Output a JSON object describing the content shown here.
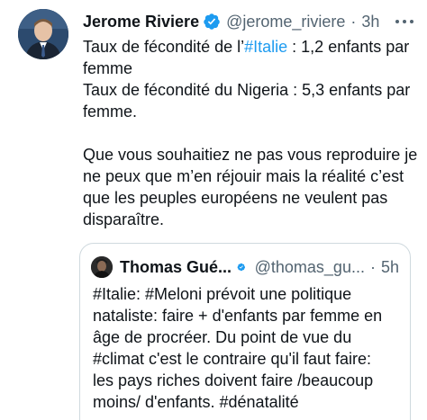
{
  "tweet": {
    "author": {
      "name": "Jerome Riviere",
      "handle": "@jerome_riviere",
      "separator": "·",
      "time": "3h"
    },
    "lines": [
      {
        "parts": [
          {
            "text": "Taux de fécondité de l’"
          },
          {
            "text": "#Italie",
            "hashtag": true
          },
          {
            "text": " : 1,2 enfants par"
          }
        ]
      },
      {
        "parts": [
          {
            "text": "femme"
          }
        ]
      },
      {
        "parts": [
          {
            "text": "Taux de fécondité du Nigeria : 5,3 enfants par"
          }
        ]
      },
      {
        "parts": [
          {
            "text": "femme."
          }
        ]
      },
      {
        "gap": true
      },
      {
        "parts": [
          {
            "text": "Que vous souhaitiez ne pas vous reproduire je"
          }
        ]
      },
      {
        "parts": [
          {
            "text": "ne peux que m’en réjouir mais la réalité c’est"
          }
        ]
      },
      {
        "parts": [
          {
            "text": "que les peuples européens ne veulent pas"
          }
        ]
      },
      {
        "parts": [
          {
            "text": "disparaître."
          }
        ]
      }
    ]
  },
  "quote": {
    "author": {
      "name": "Thomas Gué...",
      "handle": "@thomas_gu...",
      "separator": "·",
      "time": "5h"
    },
    "lines": [
      "#Italie: #Meloni prévoit une politique",
      "nataliste: faire + d'enfants par femme en",
      "âge de procréer. Du point de vue du",
      "#climat c'est le contraire qu'il faut faire:",
      "les pays riches doivent faire /beaucoup",
      "moins/ d'enfants. #dénatalité"
    ]
  },
  "colors": {
    "text": "#0f1419",
    "secondary": "#536471",
    "accent": "#1d9bf0",
    "border": "#cfd9de"
  },
  "icons": {
    "verified": "verified-badge-icon",
    "more": "more-options-icon"
  }
}
